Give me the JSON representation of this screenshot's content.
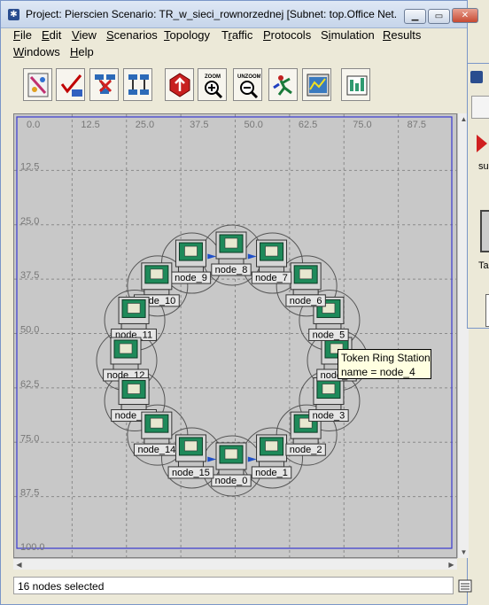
{
  "window": {
    "title": "Project: Pierscien Scenario: TR_w_sieci_rownorzednej  [Subnet: top.Office Net..."
  },
  "menu": [
    {
      "label": "File",
      "mnemonic": "F"
    },
    {
      "label": "Edit",
      "mnemonic": "E"
    },
    {
      "label": "View",
      "mnemonic": "V"
    },
    {
      "label": "Scenarios",
      "mnemonic": "S"
    },
    {
      "label": "Topology",
      "mnemonic": "T"
    },
    {
      "label": "Traffic",
      "mnemonic": "r"
    },
    {
      "label": "Protocols",
      "mnemonic": "P"
    },
    {
      "label": "Simulation",
      "mnemonic": "i"
    },
    {
      "label": "Results",
      "mnemonic": "R"
    },
    {
      "label": "Windows",
      "mnemonic": "W"
    },
    {
      "label": "Help",
      "mnemonic": "H"
    }
  ],
  "toolbar": {
    "buttons": [
      {
        "name": "object-palette",
        "icon": "palette-icon"
      },
      {
        "name": "verify-links",
        "icon": "check-links-icon"
      },
      {
        "name": "fail-nodes",
        "icon": "fail-node-icon"
      },
      {
        "name": "recover-nodes",
        "icon": "recover-node-icon"
      },
      {
        "name": "return-to-parent",
        "icon": "parent-subnet-icon"
      },
      {
        "name": "zoom",
        "icon": "zoom-in-icon",
        "label": "ZOOM"
      },
      {
        "name": "unzoom",
        "icon": "zoom-out-icon",
        "label": "UNZOOM"
      },
      {
        "name": "configure-simulation",
        "icon": "run-simulation-icon"
      },
      {
        "name": "view-results",
        "icon": "results-icon"
      },
      {
        "name": "web-report",
        "icon": "web-report-icon"
      }
    ]
  },
  "grid": {
    "x_labels": [
      "0.0",
      "12.5",
      "25.0",
      "37.5",
      "50.0",
      "62.5",
      "75.0",
      "87.5"
    ],
    "y_labels": [
      "12.5",
      "25.0",
      "37.5",
      "50.0",
      "62.5",
      "75.0",
      "87.5",
      "100.0"
    ]
  },
  "nodes": [
    {
      "label": "node_0",
      "angle": 90
    },
    {
      "label": "node_1",
      "angle": 67.5
    },
    {
      "label": "node_2",
      "angle": 45
    },
    {
      "label": "node_3",
      "angle": 22.5
    },
    {
      "label": "node_4",
      "angle": 0
    },
    {
      "label": "node_5",
      "angle": -22.5
    },
    {
      "label": "node_6",
      "angle": -45
    },
    {
      "label": "node_7",
      "angle": -67.5
    },
    {
      "label": "node_8",
      "angle": -90
    },
    {
      "label": "node_9",
      "angle": -112.5
    },
    {
      "label": "node_10",
      "angle": -135
    },
    {
      "label": "node_11",
      "angle": -157.5
    },
    {
      "label": "node_12",
      "angle": 180
    },
    {
      "label": "node_13",
      "angle": 157.5
    },
    {
      "label": "node_14",
      "angle": 135
    },
    {
      "label": "node_15",
      "angle": 112.5
    }
  ],
  "tooltip": {
    "line1": "Token Ring Station",
    "line2": "name = node_4"
  },
  "status": {
    "text": "16 nodes selected"
  },
  "side_panel": {
    "items": [
      "su",
      "Ta"
    ]
  },
  "colors": {
    "canvas_bg": "#c8c8c8",
    "grid_line": "#8a8a8a",
    "selection_border": "#3a3ad0",
    "station_screen": "#1e8a5a",
    "link_arrow": "#2050c8"
  }
}
